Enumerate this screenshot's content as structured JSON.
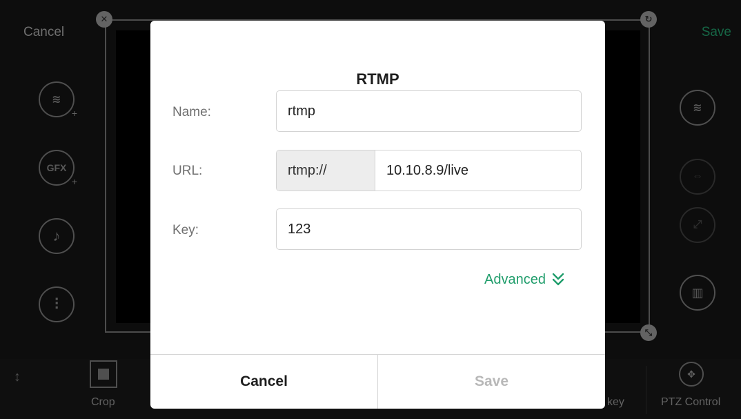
{
  "background": {
    "top_cancel": "Cancel",
    "top_save": "Save",
    "left_tools": [
      {
        "icon": "layers-add-icon",
        "glyph": "≋"
      },
      {
        "icon": "gfx-add-icon",
        "glyph": "GFX"
      },
      {
        "icon": "music-note-icon",
        "glyph": "♪"
      },
      {
        "icon": "mixer-icon",
        "glyph": "⫶"
      }
    ],
    "right_tools": [
      {
        "icon": "layers-select-icon",
        "glyph": "≋"
      },
      {
        "icon": "move-layer-icon",
        "glyph": "⇔"
      },
      {
        "icon": "expand-icon",
        "glyph": "⤢"
      },
      {
        "icon": "trash-icon",
        "glyph": "🗑"
      }
    ],
    "bottom": {
      "crop_label": "Crop",
      "key_label": "key",
      "ptz_label": "PTZ Control"
    }
  },
  "dialog": {
    "title": "RTMP",
    "name_label": "Name:",
    "name_value": "rtmp",
    "url_label": "URL:",
    "url_prefix": "rtmp://",
    "url_value": "10.10.8.9/live",
    "key_label": "Key:",
    "key_value": "123",
    "advanced_label": "Advanced",
    "cancel_label": "Cancel",
    "save_label": "Save"
  },
  "colors": {
    "accent": "#1f9d6b",
    "save_disabled": "#b8b8b8"
  }
}
